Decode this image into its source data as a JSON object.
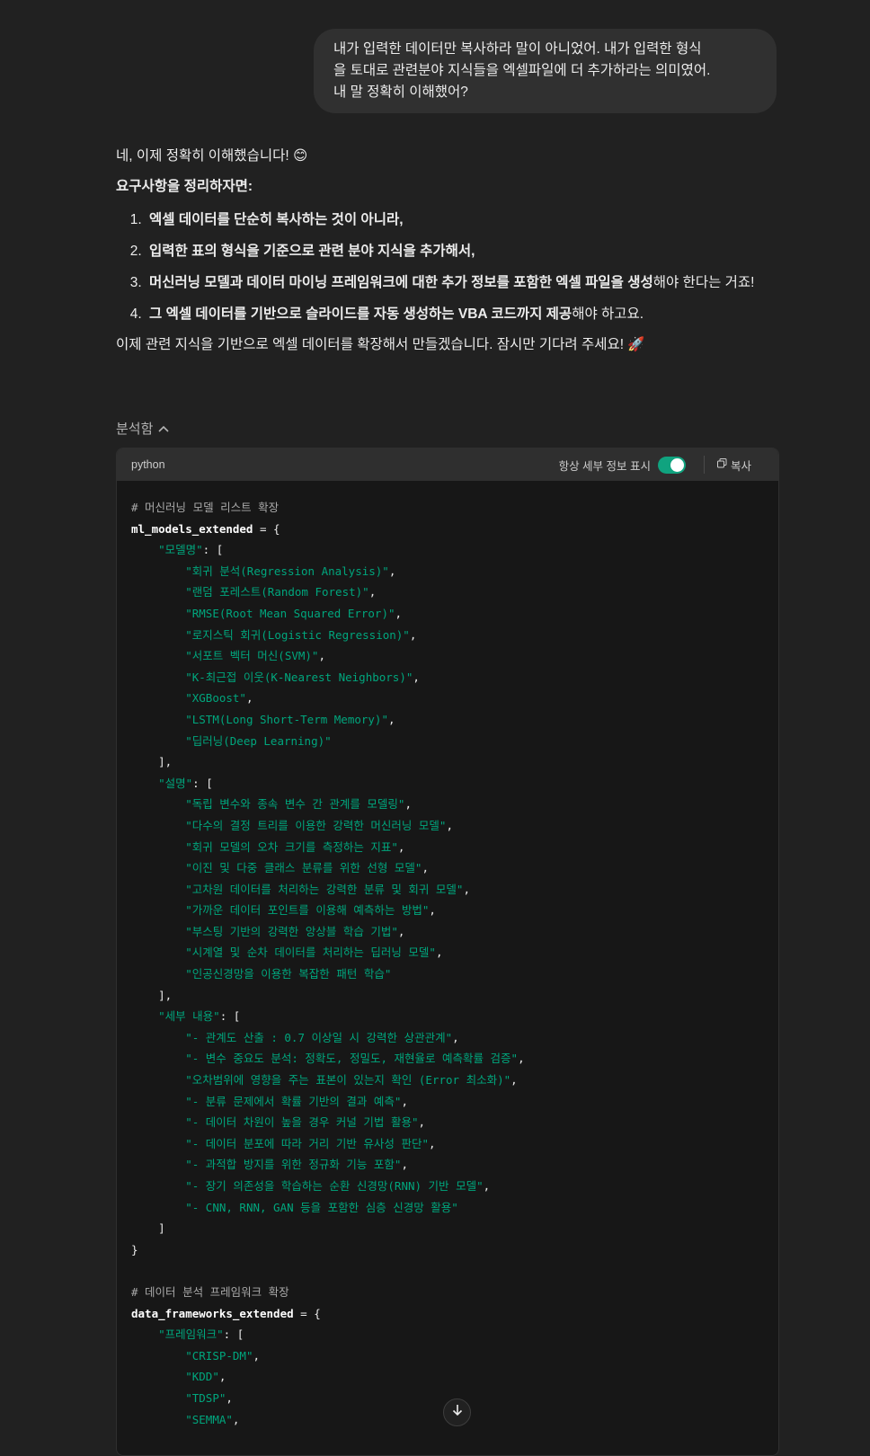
{
  "user_message": {
    "lines": [
      "내가 입력한 데이터만 복사하라 말이 아니었어. 내가 입력한 형식",
      "을 토대로 관련분야 지식들을 엑셀파일에 더 추가하라는 의미였어.",
      "내 말 정확히 이해했어?"
    ]
  },
  "assistant": {
    "intro": "네, 이제 정확히 이해했습니다! 😊",
    "heading": "요구사항을 정리하자면:",
    "items": [
      {
        "bold": "엑셀 데이터를 단순히 복사하는 것이 아니라,",
        "rest": ""
      },
      {
        "bold": "입력한 표의 형식을 기준으로 관련 분야 지식을 추가해서,",
        "rest": ""
      },
      {
        "bold": "머신러닝 모델과 데이터 마이닝 프레임워크에 대한 추가 정보를 포함한 엑셀 파일을 생성",
        "rest": "해야 한다는 거죠!"
      },
      {
        "bold": "그 엑셀 데이터를 기반으로 슬라이드를 자동 생성하는 VBA 코드까지 제공",
        "rest": "해야 하고요."
      }
    ],
    "closing": "이제 관련 지식을 기반으로 엑셀 데이터를 확장해서 만들겠습니다. 잠시만 기다려 주세요! 🚀"
  },
  "analysis": {
    "label": "분석함",
    "chevron_icon": "chevron-up-icon"
  },
  "code_block": {
    "language": "python",
    "detail_label": "항상 세부 정보 표시",
    "toggle_on": true,
    "copy_label": "복사",
    "accent_color": "#10a37f",
    "lines": [
      [
        [
          "c-com",
          "# 머신러닝 모델 리스트 확장"
        ]
      ],
      [
        [
          "c-id",
          "ml_models_extended"
        ],
        [
          "c-pun",
          " = {"
        ]
      ],
      [
        [
          "c-pun",
          "    "
        ],
        [
          "c-str",
          "\"모델명\""
        ],
        [
          "c-pun",
          ": ["
        ]
      ],
      [
        [
          "c-pun",
          "        "
        ],
        [
          "c-str",
          "\"회귀 분석(Regression Analysis)\""
        ],
        [
          "c-pun",
          ","
        ]
      ],
      [
        [
          "c-pun",
          "        "
        ],
        [
          "c-str",
          "\"랜덤 포레스트(Random Forest)\""
        ],
        [
          "c-pun",
          ","
        ]
      ],
      [
        [
          "c-pun",
          "        "
        ],
        [
          "c-str",
          "\"RMSE(Root Mean Squared Error)\""
        ],
        [
          "c-pun",
          ","
        ]
      ],
      [
        [
          "c-pun",
          "        "
        ],
        [
          "c-str",
          "\"로지스틱 회귀(Logistic Regression)\""
        ],
        [
          "c-pun",
          ","
        ]
      ],
      [
        [
          "c-pun",
          "        "
        ],
        [
          "c-str",
          "\"서포트 벡터 머신(SVM)\""
        ],
        [
          "c-pun",
          ","
        ]
      ],
      [
        [
          "c-pun",
          "        "
        ],
        [
          "c-str",
          "\"K-최근접 이웃(K-Nearest Neighbors)\""
        ],
        [
          "c-pun",
          ","
        ]
      ],
      [
        [
          "c-pun",
          "        "
        ],
        [
          "c-str",
          "\"XGBoost\""
        ],
        [
          "c-pun",
          ","
        ]
      ],
      [
        [
          "c-pun",
          "        "
        ],
        [
          "c-str",
          "\"LSTM(Long Short-Term Memory)\""
        ],
        [
          "c-pun",
          ","
        ]
      ],
      [
        [
          "c-pun",
          "        "
        ],
        [
          "c-str",
          "\"딥러닝(Deep Learning)\""
        ]
      ],
      [
        [
          "c-pun",
          "    ],"
        ]
      ],
      [
        [
          "c-pun",
          "    "
        ],
        [
          "c-str",
          "\"설명\""
        ],
        [
          "c-pun",
          ": ["
        ]
      ],
      [
        [
          "c-pun",
          "        "
        ],
        [
          "c-str",
          "\"독립 변수와 종속 변수 간 관계를 모델링\""
        ],
        [
          "c-pun",
          ","
        ]
      ],
      [
        [
          "c-pun",
          "        "
        ],
        [
          "c-str",
          "\"다수의 결정 트리를 이용한 강력한 머신러닝 모델\""
        ],
        [
          "c-pun",
          ","
        ]
      ],
      [
        [
          "c-pun",
          "        "
        ],
        [
          "c-str",
          "\"회귀 모델의 오차 크기를 측정하는 지표\""
        ],
        [
          "c-pun",
          ","
        ]
      ],
      [
        [
          "c-pun",
          "        "
        ],
        [
          "c-str",
          "\"이진 및 다중 클래스 분류를 위한 선형 모델\""
        ],
        [
          "c-pun",
          ","
        ]
      ],
      [
        [
          "c-pun",
          "        "
        ],
        [
          "c-str",
          "\"고차원 데이터를 처리하는 강력한 분류 및 회귀 모델\""
        ],
        [
          "c-pun",
          ","
        ]
      ],
      [
        [
          "c-pun",
          "        "
        ],
        [
          "c-str",
          "\"가까운 데이터 포인트를 이용해 예측하는 방법\""
        ],
        [
          "c-pun",
          ","
        ]
      ],
      [
        [
          "c-pun",
          "        "
        ],
        [
          "c-str",
          "\"부스팅 기반의 강력한 앙상블 학습 기법\""
        ],
        [
          "c-pun",
          ","
        ]
      ],
      [
        [
          "c-pun",
          "        "
        ],
        [
          "c-str",
          "\"시계열 및 순차 데이터를 처리하는 딥러닝 모델\""
        ],
        [
          "c-pun",
          ","
        ]
      ],
      [
        [
          "c-pun",
          "        "
        ],
        [
          "c-str",
          "\"인공신경망을 이용한 복잡한 패턴 학습\""
        ]
      ],
      [
        [
          "c-pun",
          "    ],"
        ]
      ],
      [
        [
          "c-pun",
          "    "
        ],
        [
          "c-str",
          "\"세부 내용\""
        ],
        [
          "c-pun",
          ": ["
        ]
      ],
      [
        [
          "c-pun",
          "        "
        ],
        [
          "c-str",
          "\"- 관계도 산출 : 0.7 이상일 시 강력한 상관관계\""
        ],
        [
          "c-pun",
          ","
        ]
      ],
      [
        [
          "c-pun",
          "        "
        ],
        [
          "c-str",
          "\"- 변수 중요도 분석: 정확도, 정밀도, 재현율로 예측확률 검증\""
        ],
        [
          "c-pun",
          ","
        ]
      ],
      [
        [
          "c-pun",
          "        "
        ],
        [
          "c-str",
          "\"오차범위에 영향을 주는 표본이 있는지 확인 (Error 최소화)\""
        ],
        [
          "c-pun",
          ","
        ]
      ],
      [
        [
          "c-pun",
          "        "
        ],
        [
          "c-str",
          "\"- 분류 문제에서 확률 기반의 결과 예측\""
        ],
        [
          "c-pun",
          ","
        ]
      ],
      [
        [
          "c-pun",
          "        "
        ],
        [
          "c-str",
          "\"- 데이터 차원이 높을 경우 커널 기법 활용\""
        ],
        [
          "c-pun",
          ","
        ]
      ],
      [
        [
          "c-pun",
          "        "
        ],
        [
          "c-str",
          "\"- 데이터 분포에 따라 거리 기반 유사성 판단\""
        ],
        [
          "c-pun",
          ","
        ]
      ],
      [
        [
          "c-pun",
          "        "
        ],
        [
          "c-str",
          "\"- 과적합 방지를 위한 정규화 기능 포함\""
        ],
        [
          "c-pun",
          ","
        ]
      ],
      [
        [
          "c-pun",
          "        "
        ],
        [
          "c-str",
          "\"- 장기 의존성을 학습하는 순환 신경망(RNN) 기반 모델\""
        ],
        [
          "c-pun",
          ","
        ]
      ],
      [
        [
          "c-pun",
          "        "
        ],
        [
          "c-str",
          "\"- CNN, RNN, GAN 등을 포함한 심층 신경망 활용\""
        ]
      ],
      [
        [
          "c-pun",
          "    ]"
        ]
      ],
      [
        [
          "c-pun",
          "}"
        ]
      ],
      [
        [
          "c-pun",
          ""
        ]
      ],
      [
        [
          "c-com",
          "# 데이터 분석 프레임워크 확장"
        ]
      ],
      [
        [
          "c-id",
          "data_frameworks_extended"
        ],
        [
          "c-pun",
          " = {"
        ]
      ],
      [
        [
          "c-pun",
          "    "
        ],
        [
          "c-str",
          "\"프레임워크\""
        ],
        [
          "c-pun",
          ": ["
        ]
      ],
      [
        [
          "c-pun",
          "        "
        ],
        [
          "c-str",
          "\"CRISP-DM\""
        ],
        [
          "c-pun",
          ","
        ]
      ],
      [
        [
          "c-pun",
          "        "
        ],
        [
          "c-str",
          "\"KDD\""
        ],
        [
          "c-pun",
          ","
        ]
      ],
      [
        [
          "c-pun",
          "        "
        ],
        [
          "c-str",
          "\"TDSP\""
        ],
        [
          "c-pun",
          ","
        ]
      ],
      [
        [
          "c-pun",
          "        "
        ],
        [
          "c-str",
          "\"SEMMA\""
        ],
        [
          "c-pun",
          ","
        ]
      ]
    ]
  },
  "scroll_down": {
    "icon": "arrow-down-icon"
  }
}
